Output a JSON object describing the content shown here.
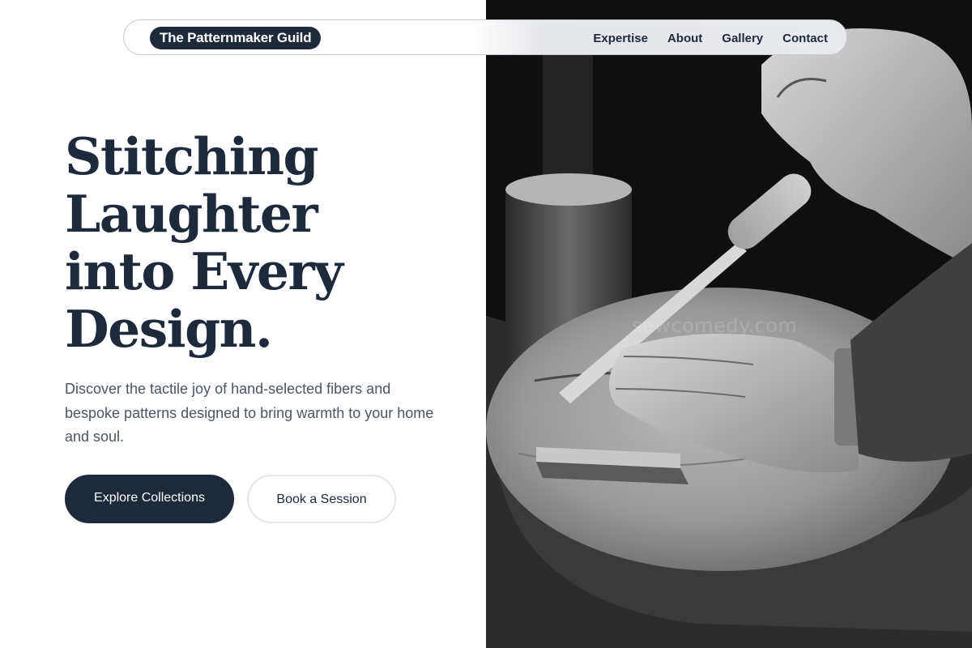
{
  "nav": {
    "brand": "The Patternmaker Guild",
    "links": [
      "Expertise",
      "About",
      "Gallery",
      "Contact"
    ]
  },
  "hero": {
    "title_lines": [
      "Stitching",
      "Laughter",
      "into Every",
      "Design."
    ],
    "subtitle": "Discover the tactile joy of hand-selected fibers and bespoke patterns designed to bring warmth to your home and soul.",
    "primary_button": "Explore Collections",
    "secondary_button": "Book a Session"
  },
  "image": {
    "alt": "Black and white photo of hands carving a wooden block with a chisel on a tree-stump workbench",
    "watermark": "sewcomedy.com"
  },
  "colors": {
    "primary": "#1e293b",
    "text_muted": "#4b5563",
    "border": "#e5e7eb",
    "photo_background": "#0e0e0e"
  }
}
